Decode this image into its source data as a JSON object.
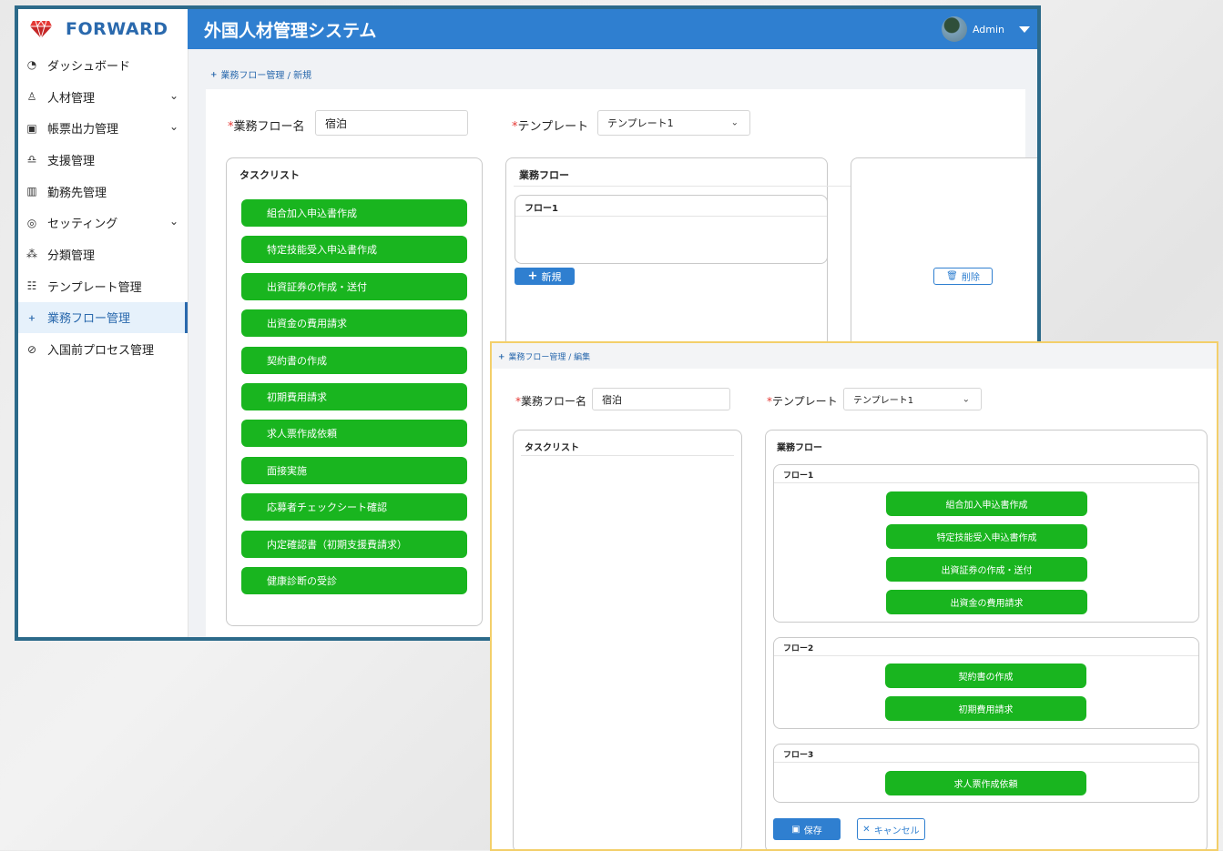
{
  "brand": {
    "name": "FORWARD",
    "accent": "#2a69ad"
  },
  "header": {
    "title": "外国人材管理システム",
    "user": "Admin",
    "color": "#2f7fd0"
  },
  "sidebar": {
    "items": [
      {
        "label": "ダッシュボード",
        "icon": "dashboard-icon"
      },
      {
        "label": "人材管理",
        "icon": "person-icon",
        "expandable": true
      },
      {
        "label": "帳票出力管理",
        "icon": "form-icon",
        "expandable": true
      },
      {
        "label": "支援管理",
        "icon": "support-icon"
      },
      {
        "label": "勤務先管理",
        "icon": "building-icon"
      },
      {
        "label": "セッティング",
        "icon": "settings-icon",
        "expandable": true
      },
      {
        "label": "分類管理",
        "icon": "hierarchy-icon"
      },
      {
        "label": "テンプレート管理",
        "icon": "template-icon"
      },
      {
        "label": "業務フロー管理",
        "icon": "flow-icon",
        "active": true
      },
      {
        "label": "入国前プロセス管理",
        "icon": "process-icon"
      }
    ]
  },
  "back": {
    "breadcrumb": "業務フロー管理 / 新規",
    "flow_name_label": "業務フロー名",
    "flow_name_value": "宿泊",
    "template_label": "テンプレート",
    "template_value": "テンプレート1",
    "tasklist_title": "タスクリスト",
    "tasks": [
      "組合加入申込書作成",
      "特定技能受入申込書作成",
      "出資証券の作成・送付",
      "出資金の費用請求",
      "契約書の作成",
      "初期費用請求",
      "求人票作成依頼",
      "面接実施",
      "応募者チェックシート確認",
      "内定確認書（初期支援費請求）",
      "健康診断の受診"
    ],
    "flow_panel_title": "業務フロー",
    "flow1_title": "フロー1",
    "new_button": "新規",
    "delete_button": "削除"
  },
  "front": {
    "breadcrumb": "業務フロー管理 / 編集",
    "flow_name_label": "業務フロー名",
    "flow_name_value": "宿泊",
    "template_label": "テンプレート",
    "template_value": "テンプレート1",
    "tasklist_title": "タスクリスト",
    "flow_panel_title": "業務フロー",
    "flows": [
      {
        "title": "フロー1",
        "tasks": [
          "組合加入申込書作成",
          "特定技能受入申込書作成",
          "出資証券の作成・送付",
          "出資金の費用請求"
        ]
      },
      {
        "title": "フロー2",
        "tasks": [
          "契約書の作成",
          "初期費用請求"
        ]
      },
      {
        "title": "フロー3",
        "tasks": [
          "求人票作成依頼"
        ]
      }
    ],
    "save_button": "保存",
    "cancel_button": "キャンセル"
  },
  "colors": {
    "task_green": "#19b51f",
    "required": "#e53935",
    "front_border": "#f3cf6a"
  }
}
